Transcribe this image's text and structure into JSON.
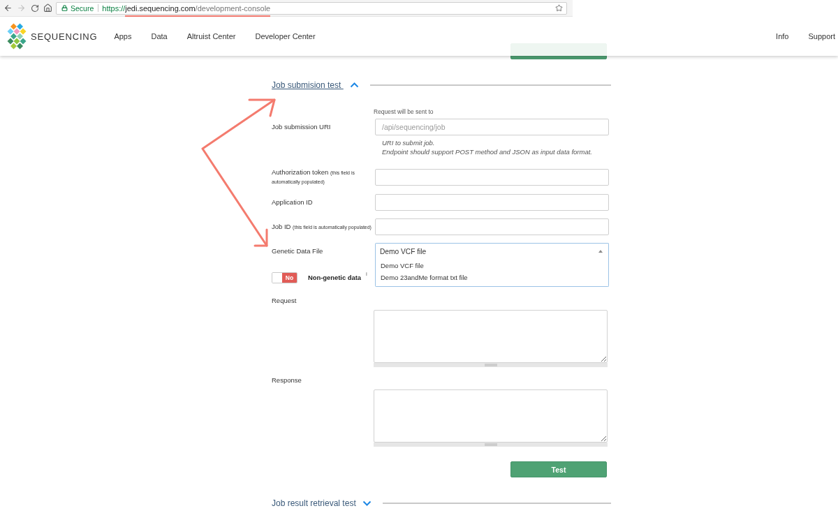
{
  "browser": {
    "secure_label": "Secure",
    "url": {
      "scheme": "https://",
      "host": "jedi.sequencing.com",
      "path": "/development-console"
    }
  },
  "navbar": {
    "brand": "SEQUENCING",
    "menu": [
      "Apps",
      "Data",
      "Altruist Center",
      "Developer Center"
    ],
    "right_menu": [
      "Info",
      "Support"
    ]
  },
  "sections": [
    {
      "title": "Job submision test",
      "expanded": true,
      "fields": [
        {
          "kind": "text",
          "caption": "Request will be sent to",
          "label": "Job submission URI",
          "placeholder": "/api/sequencing/job",
          "hint": [
            "URI to submit job.",
            "Endpoint should support POST method and JSON as input data format."
          ]
        },
        {
          "kind": "text",
          "label": "Authorization token",
          "note": "(this field is automatically populated)"
        },
        {
          "kind": "text",
          "label": "Application ID"
        },
        {
          "kind": "text",
          "label": "Job ID",
          "note": "(this field is automatically populated)"
        },
        {
          "kind": "select",
          "label": "Genetic Data File",
          "value": "Demo VCF file",
          "expanded": true,
          "options": [
            "Demo VCF file",
            "Demo 23andMe format txt file"
          ]
        },
        {
          "kind": "toggle",
          "on": false,
          "state_label": "No",
          "label": "Non-genetic data",
          "info": "i"
        },
        {
          "kind": "textarea",
          "label": "Request"
        },
        {
          "kind": "textarea",
          "label": "Response"
        }
      ],
      "button": "Test"
    },
    {
      "title": "Job result retrieval test",
      "expanded": false
    }
  ]
}
